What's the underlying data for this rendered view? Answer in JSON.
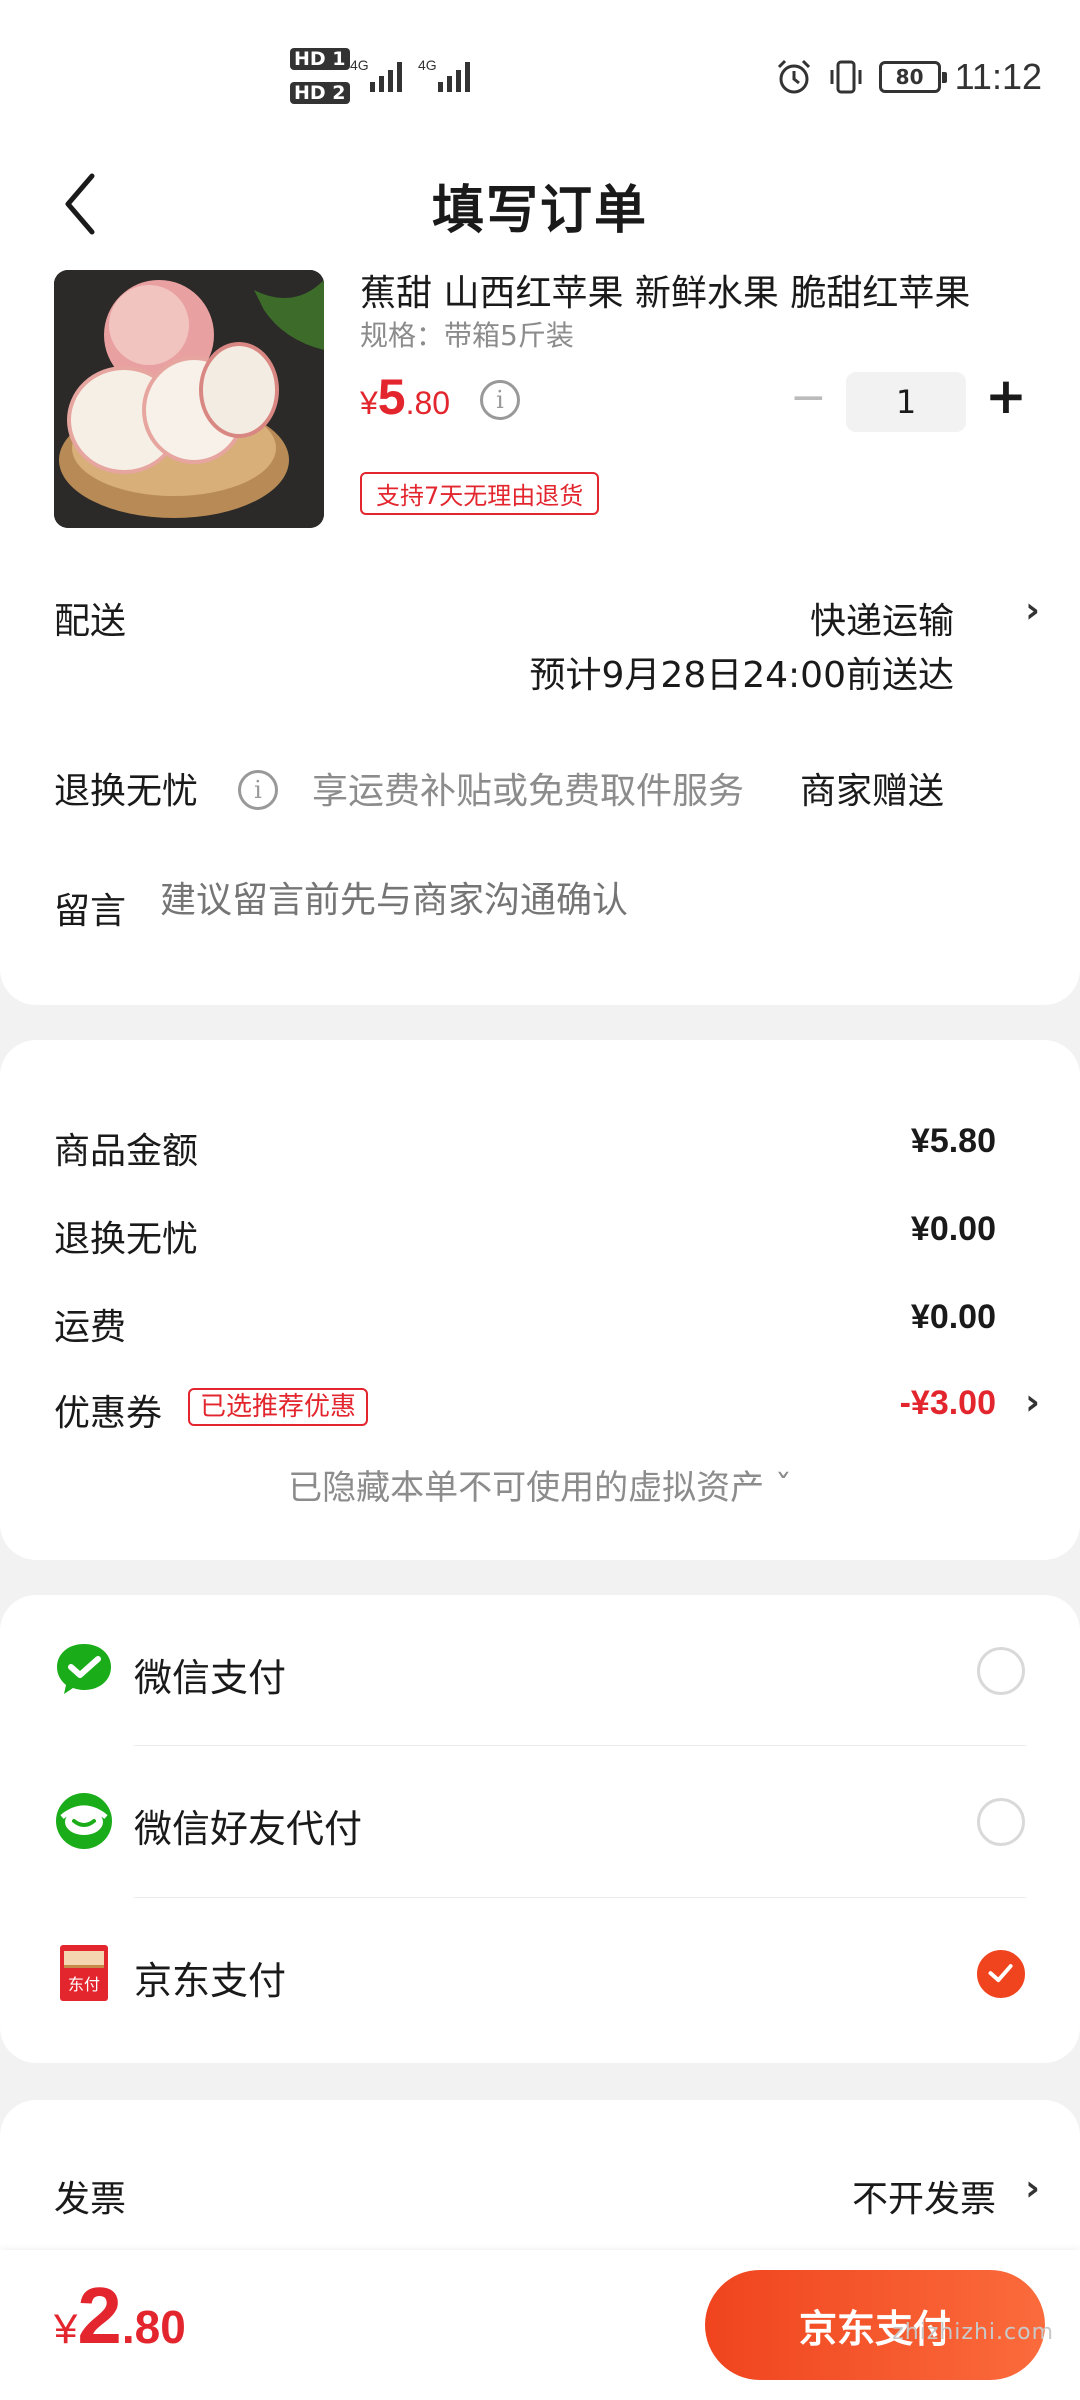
{
  "status_bar": {
    "hd1": "HD 1",
    "hd2": "HD 2",
    "net1": "4G",
    "net2": "4G",
    "battery": "80",
    "time": "11:12"
  },
  "header": {
    "title": "填写订单"
  },
  "product": {
    "title": "蕉甜 山西红苹果 新鲜水果 脆甜红苹果",
    "spec": "规格：带箱5斤装",
    "price_symbol": "¥",
    "price_int": "5",
    "price_dec": ".80",
    "quantity": "1",
    "minus": "−",
    "plus": "+",
    "return_tag": "支持7天无理由退货"
  },
  "delivery": {
    "label": "配送",
    "method": "快递运输",
    "estimate": "预计9月28日24:00前送达"
  },
  "return_service": {
    "label": "退换无忧",
    "desc": "享运费补贴或免费取件服务",
    "value": "商家赠送"
  },
  "message": {
    "label": "留言",
    "placeholder": "建议留言前先与商家沟通确认"
  },
  "summary": {
    "goods_label": "商品金额",
    "goods_value": "¥5.80",
    "return_label": "退换无忧",
    "return_value": "¥0.00",
    "shipping_label": "运费",
    "shipping_value": "¥0.00",
    "coupon_label": "优惠券",
    "coupon_tag": "已选推荐优惠",
    "coupon_value": "-¥3.00",
    "hidden_assets": "已隐藏本单不可使用的虚拟资产 ˇ"
  },
  "payment": {
    "wechat": "微信支付",
    "wechat_friend": "微信好友代付",
    "jd": "京东支付",
    "jd_icon_text": "东付",
    "selected": "jd"
  },
  "invoice": {
    "label": "发票",
    "value": "不开发票"
  },
  "bottom": {
    "total_symbol": "¥",
    "total_int": "2",
    "total_dec": ".80",
    "pay_button": "京东支付"
  },
  "watermark": "zhizhizhi.com",
  "colors": {
    "accent": "#e3262e",
    "button": "#f0441e",
    "wechat_green": "#1aad19"
  }
}
